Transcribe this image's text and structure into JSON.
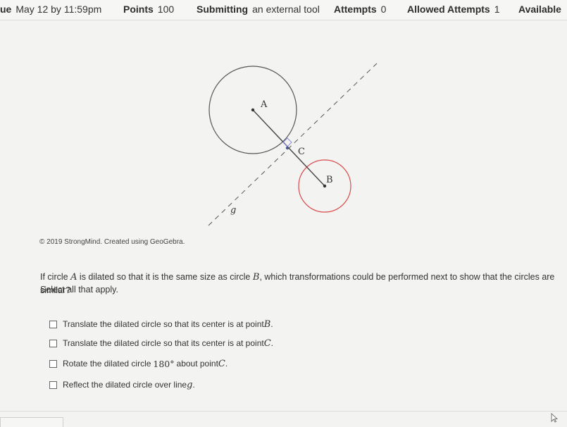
{
  "header": {
    "due_label": "ue",
    "due_value": "May 12 by 11:59pm",
    "points_label": "Points",
    "points_value": "100",
    "submitting_label": "Submitting",
    "submitting_value": "an external tool",
    "attempts_label": "Attempts",
    "attempts_value": "0",
    "allowed_label": "Allowed Attempts",
    "allowed_value": "1",
    "available_label": "Available"
  },
  "figure": {
    "label_A": "A",
    "label_B": "B",
    "label_C": "C",
    "label_g": "g",
    "credit": "© 2019 StrongMind. Created using GeoGebra."
  },
  "question": {
    "part1": "If circle ",
    "var_A": "A",
    "part2": " is dilated so that it is the same size as circle ",
    "var_B": "B",
    "part3": ", which transformations could be performed next to show that the circles are similar?",
    "instruction": "Select all that apply."
  },
  "options": [
    {
      "pre": "Translate the dilated circle so that its center is at point ",
      "var": "B",
      "post": "."
    },
    {
      "pre": "Translate the dilated circle so that its center is at point ",
      "var": "C",
      "post": "."
    },
    {
      "pre": "Rotate the dilated circle",
      "num": "180°",
      "mid": "about point ",
      "var": "C",
      "post": "."
    },
    {
      "pre": "Reflect the dilated circle over line ",
      "var": "g",
      "post": "."
    }
  ]
}
